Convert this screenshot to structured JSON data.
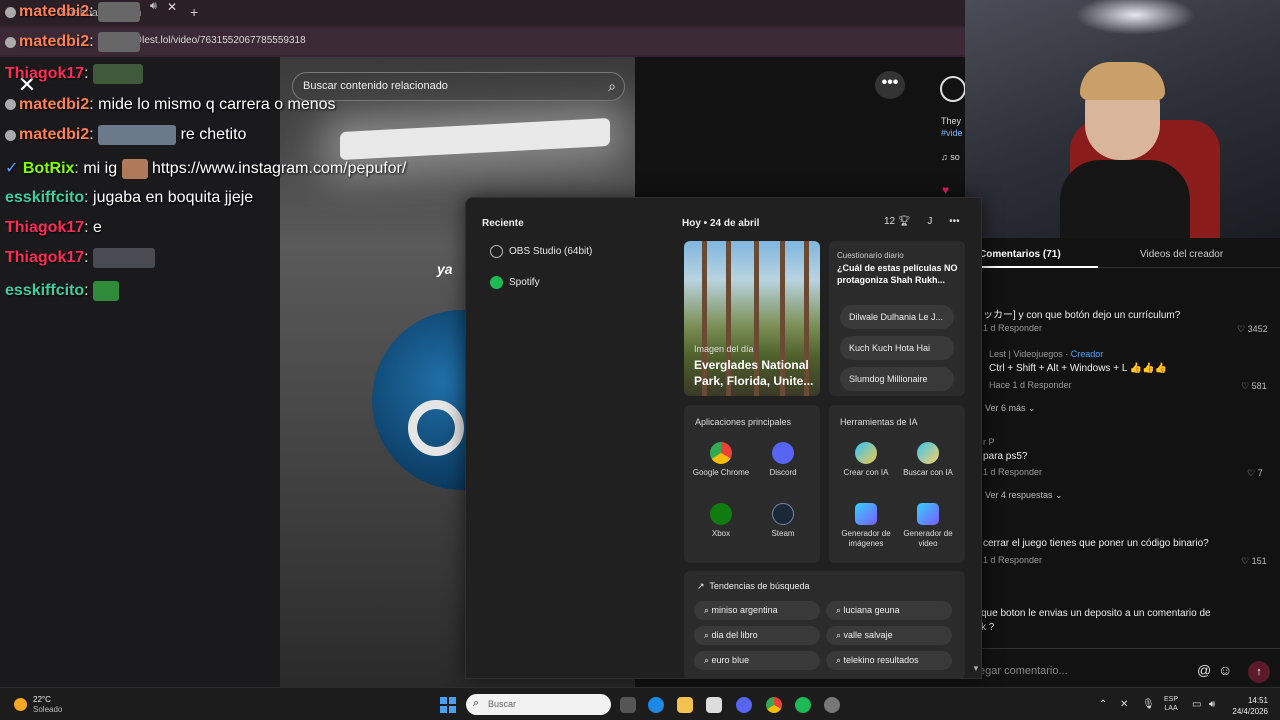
{
  "browser": {
    "tab_title": "Shabbat Shalom",
    "url": "@lest.lol/video/7631552067785559318",
    "new_tab": "+",
    "tab_close": "✕"
  },
  "video": {
    "search_placeholder": "Buscar contenido relacionado",
    "overlay_text": "ya",
    "close_label": "✕",
    "more_label": "•••",
    "side_text_1": "They",
    "side_text_2": "#vide",
    "side_text_3": "♫ so"
  },
  "chat": [
    {
      "user": "matedbi2",
      "text": "",
      "color": "#ff7f50"
    },
    {
      "user": "matedbi2",
      "text": "",
      "color": "#ff7f50"
    },
    {
      "user": "Thiagok17",
      "text": "",
      "color": "#ff2a5a"
    },
    {
      "user": "matedbi2",
      "text": "mide lo mismo q carrera o menos",
      "color": "#ff7f50"
    },
    {
      "user": "matedbi2",
      "text": "re chetito",
      "color": "#ff7f50"
    },
    {
      "user": "BotRix",
      "text": "mi ig",
      "link": "https://www.instagram.com/pepufor/",
      "color": "#7fff00"
    },
    {
      "user": "esskiffcito",
      "text": "jugaba en boquita jjeje",
      "color": "#3ccfa0"
    },
    {
      "user": "Thiagok17",
      "text": "e",
      "color": "#ff2a5a"
    },
    {
      "user": "Thiagok17",
      "text": "",
      "color": "#ff2a5a"
    },
    {
      "user": "esskiffcito",
      "text": "",
      "color": "#3ccfa0"
    }
  ],
  "comments": {
    "tab_comments": "Comentarios (71)",
    "tab_videos": "Videos del creador",
    "items": [
      {
        "text": "ッカー] y con que botón dejo un currículum?",
        "meta": "1 d   Responder",
        "likes": "♡ 3452"
      },
      {
        "author": "Lest | Videojuegos · ",
        "creator": "Creador",
        "text": "Ctrl + Shift + Alt + Windows + L 👍👍👍",
        "meta": "Hace 1 d   Responder",
        "likes": "♡ 581",
        "more": "Ver 6 más ⌄"
      },
      {
        "author": "r P",
        "text": "para ps5?",
        "meta": "1 d   Responder",
        "likes": "♡ 7",
        "more": "Ver 4 respuestas ⌄"
      },
      {
        "text": "cerrar el juego tienes que poner un código binario?",
        "meta": "1 d   Responder",
        "likes": "♡ 151"
      },
      {
        "text": "que boton le envias un deposito a un comentario de",
        "text2": "k ?"
      }
    ],
    "input_placeholder": "egar comentario..."
  },
  "widgets": {
    "recent_title": "Reciente",
    "recent_items": [
      "OBS Studio (64bit)",
      "Spotify"
    ],
    "date_label": "Hoy • 24 de abril",
    "points": "12",
    "profile_initial": "J",
    "menu": "•••",
    "photo_label": "Imagen del día",
    "photo_title": "Everglades National Park, Florida, Unite...",
    "quiz_head": "Cuestionario diario",
    "quiz_question": "¿Cuál de estas películas NO protagoniza Shah Rukh...",
    "quiz_options": [
      "Dilwale Dulhania Le J...",
      "Kuch Kuch Hota Hai",
      "Slumdog Millionaire"
    ],
    "apps_title": "Aplicaciones principales",
    "apps": [
      "Google Chrome",
      "Discord",
      "Xbox",
      "Steam"
    ],
    "ai_title": "Herramientas de IA",
    "ai_tools": [
      "Crear con IA",
      "Buscar con IA",
      "Generador de imágenes",
      "Generador de video"
    ],
    "trends_title": "Tendencias de búsqueda",
    "trends": [
      "miniso argentina",
      "luciana geuna",
      "dia del libro",
      "valle salvaje",
      "euro blue",
      "telekino resultados"
    ]
  },
  "taskbar": {
    "temp": "22°C",
    "weather": "Soleado",
    "search_placeholder": "Buscar",
    "lang_1": "ESP",
    "lang_2": "LAA",
    "time": "14:51",
    "date": "24/4/2026"
  }
}
